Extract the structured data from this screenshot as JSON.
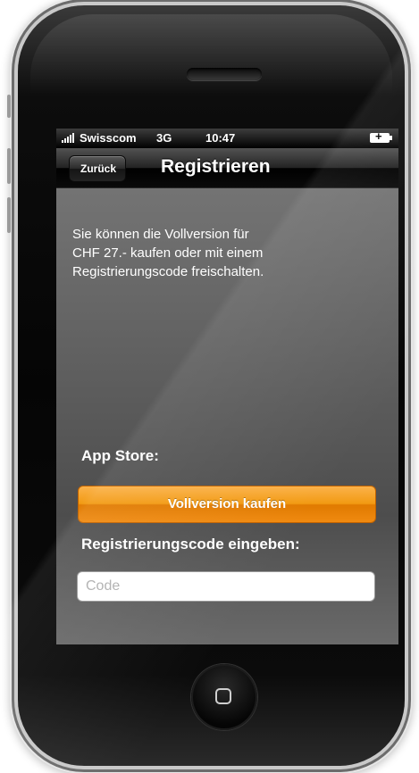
{
  "status_bar": {
    "carrier": "Swisscom",
    "network": "3G",
    "time": "10:47",
    "signal_icon": "signal-bars-icon",
    "battery_icon": "battery-charging-icon"
  },
  "nav": {
    "back_label": "Zurück",
    "title": "Registrieren"
  },
  "content": {
    "info_text": "Sie können die Vollversion für CHF 27.- kaufen oder mit einem Registrierungscode freischalten.",
    "appstore_label": "App Store:",
    "buy_button_label": "Vollversion kaufen",
    "code_label": "Registrierungscode eingeben:",
    "code_placeholder": "Code",
    "code_value": ""
  },
  "colors": {
    "accent_orange": "#f29a12",
    "nav_black": "#000000"
  },
  "device": {
    "home_button_icon": "home-button-icon"
  }
}
